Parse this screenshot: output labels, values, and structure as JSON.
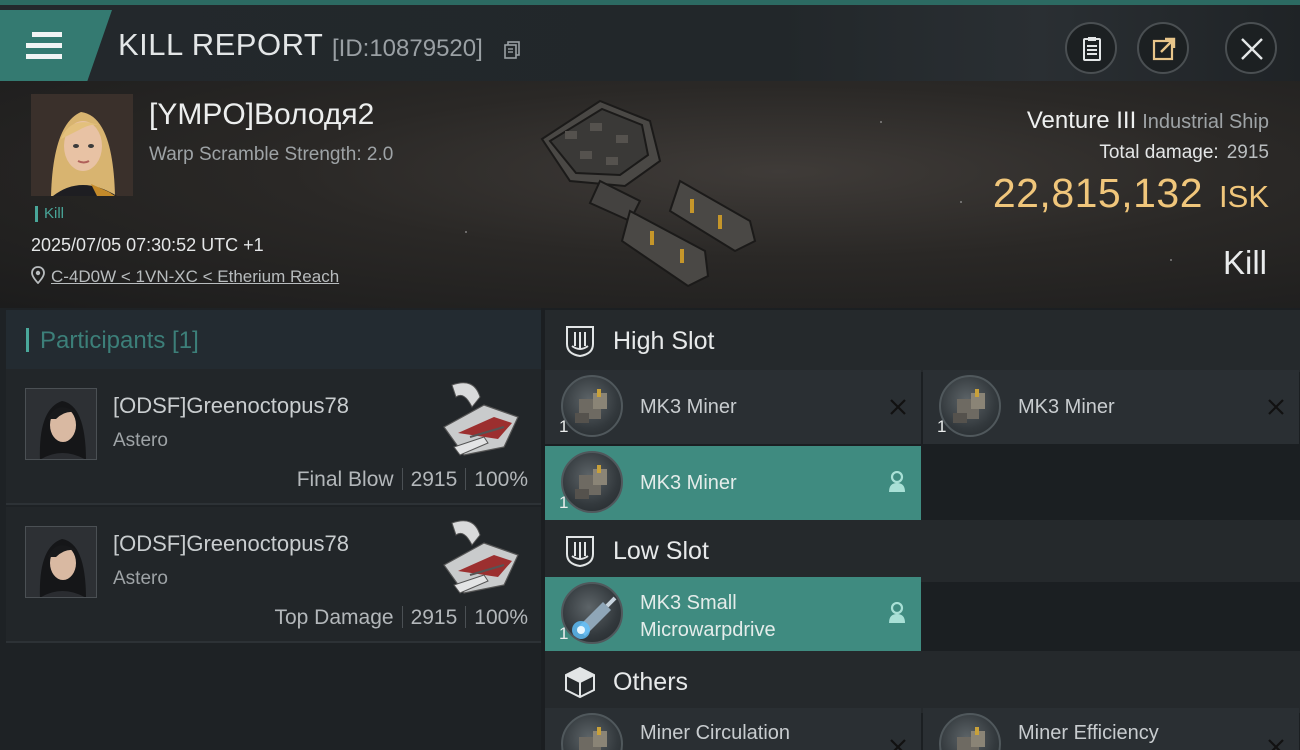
{
  "header": {
    "title": "KILL REPORT",
    "report_id": "[ID:10879520]",
    "icons": {
      "menu": "hamburger-menu-icon",
      "copy": "copy-icon",
      "report": "clipboard-icon",
      "share": "share-icon",
      "close": "close-icon"
    }
  },
  "victim": {
    "name": "[YMPO]Володя2",
    "warp_scramble": "Warp Scramble Strength: 2.0",
    "tag": "Kill",
    "datetime": "2025/07/05 07:30:52 UTC +1",
    "location": "C-4D0W < 1VN-XC < Etherium Reach",
    "ship_name": "Venture III",
    "ship_class": "Industrial Ship",
    "total_damage_label": "Total damage:",
    "total_damage": "2915",
    "isk_value": "22,815,132",
    "isk_unit": "ISK",
    "result": "Kill"
  },
  "participants": {
    "label": "Participants [1]",
    "rows": [
      {
        "name": "[ODSF]Greenoctopus78",
        "ship": "Astero",
        "role": "Final Blow",
        "damage": "2915",
        "percent": "100%"
      },
      {
        "name": "[ODSF]Greenoctopus78",
        "ship": "Astero",
        "role": "Top Damage",
        "damage": "2915",
        "percent": "100%"
      }
    ]
  },
  "fittings": {
    "high_slot": {
      "label": "High Slot",
      "modules": [
        {
          "name": "MK3 Miner",
          "qty": "1",
          "state": "destroyed"
        },
        {
          "name": "MK3 Miner",
          "qty": "1",
          "state": "destroyed"
        },
        {
          "name": "MK3 Miner",
          "qty": "1",
          "state": "dropped"
        }
      ]
    },
    "low_slot": {
      "label": "Low Slot",
      "modules": [
        {
          "name_line1": "MK3 Small",
          "name_line2": "Microwarpdrive",
          "qty": "1",
          "state": "dropped"
        }
      ]
    },
    "others": {
      "label": "Others",
      "modules": [
        {
          "name": "Miner Circulation"
        },
        {
          "name": "Miner Efficiency"
        }
      ]
    }
  },
  "colors": {
    "accent": "#3f8b80",
    "isk": "#f0c67b",
    "panel": "#2a2f33"
  }
}
